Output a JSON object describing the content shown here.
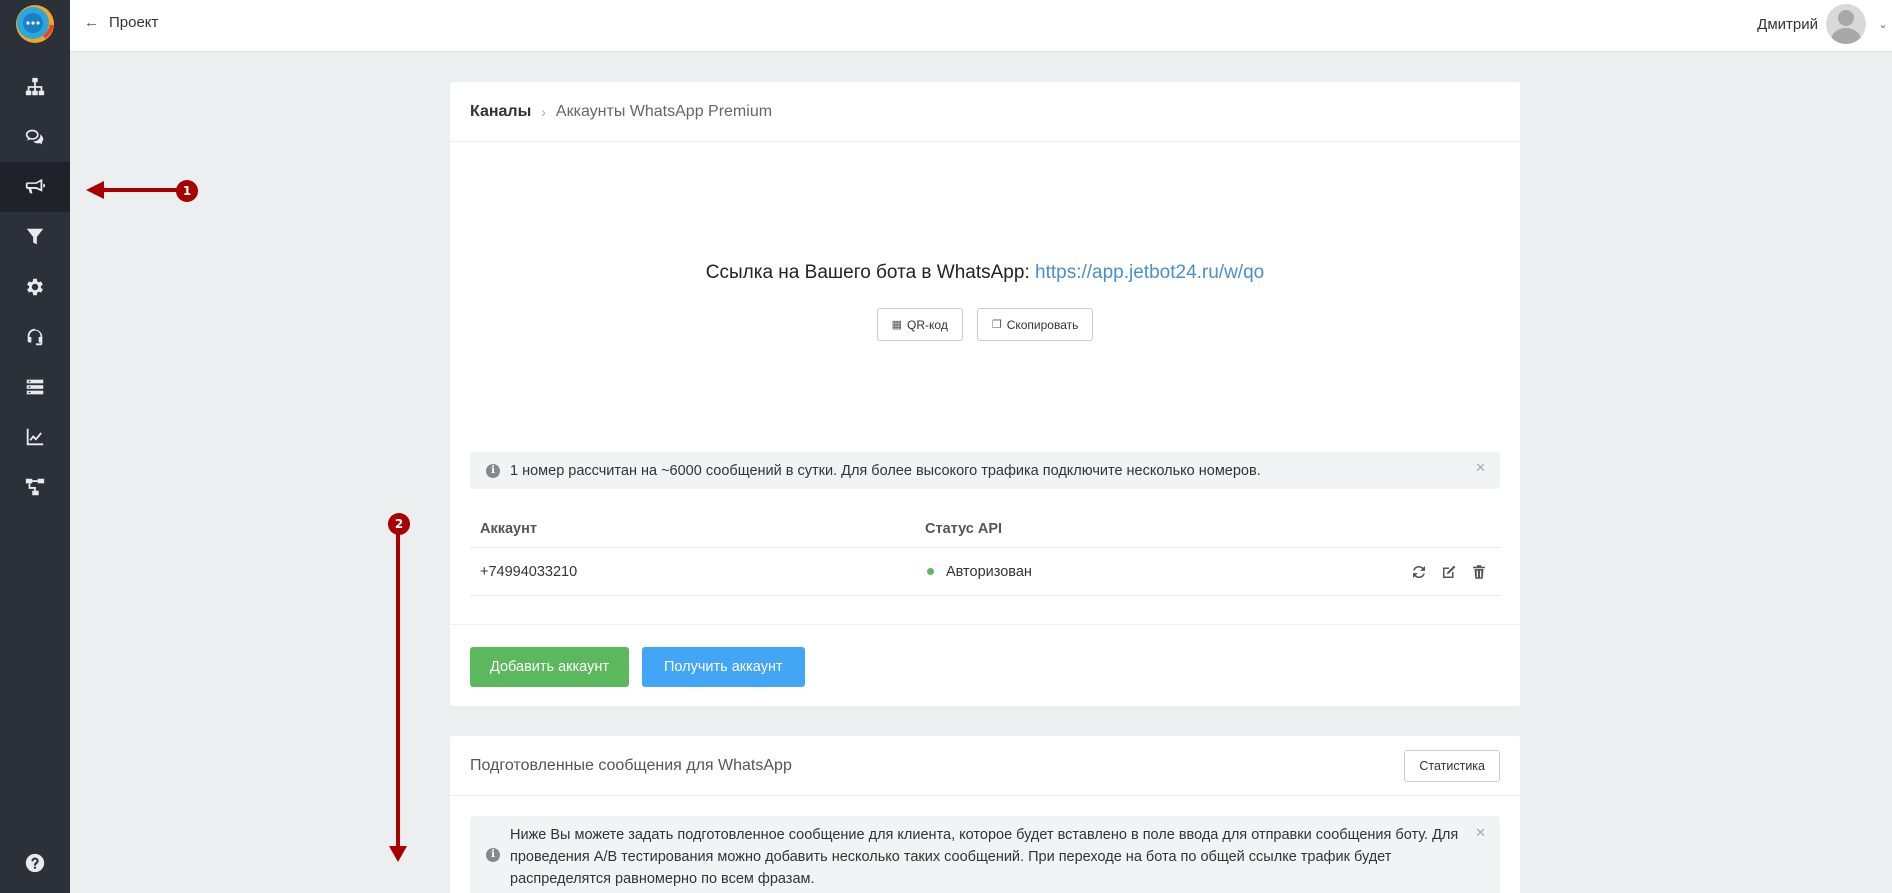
{
  "topbar": {
    "back_label": "Проект",
    "user_name": "Дмитрий"
  },
  "sidebar": {
    "items": [
      {
        "icon": "sitemap-icon"
      },
      {
        "icon": "chat-icon"
      },
      {
        "icon": "megaphone-icon",
        "active": true
      },
      {
        "icon": "funnel-icon"
      },
      {
        "icon": "gear-icon"
      },
      {
        "icon": "headset-icon"
      },
      {
        "icon": "server-icon"
      },
      {
        "icon": "chart-icon"
      },
      {
        "icon": "flow-icon"
      }
    ],
    "help_icon": "help-icon"
  },
  "channels": {
    "breadcrumb_main": "Каналы",
    "breadcrumb_sub": "Аккаунты WhatsApp Premium",
    "link_text": "Ссылка на Вашего бота в WhatsApp:",
    "link_url": "https://app.jetbot24.ru/w/qo",
    "qr_label": "QR-код",
    "copy_label": "Скопировать",
    "alert": "1 номер рассчитан на ~6000 сообщений в сутки. Для более высокого трафика подключите несколько номеров.",
    "table": {
      "col_account": "Аккаунт",
      "col_status": "Статус API",
      "rows": [
        {
          "account": "+74994033210",
          "status": "Авторизован",
          "status_color": "#5cb85c"
        }
      ]
    },
    "add_button": "Добавить аккаунт",
    "get_button": "Получить аккаунт"
  },
  "messages": {
    "title": "Подготовленные сообщения для WhatsApp",
    "stats_button": "Статистика",
    "info": "Ниже Вы можете задать подготовленное сообщение для клиента, которое будет вставлено в поле ввода для отправки сообщения боту. Для проведения A/B тестирования можно добавить несколько таких сообщений. При переходе на бота по общей ссылке трафик будет распределятся равномерно по всем фразам."
  },
  "annotations": {
    "badge1": "1",
    "badge2": "2",
    "color": "#a80000"
  },
  "colors": {
    "sidebar": "#2c3038",
    "green": "#5cb85c",
    "blue": "#42a5f5",
    "link": "#4a90c9"
  }
}
